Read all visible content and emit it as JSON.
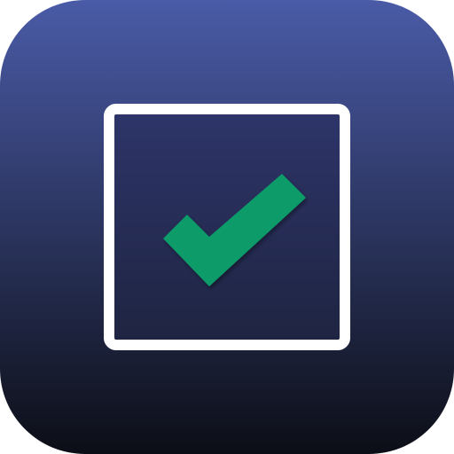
{
  "icon": {
    "name": "checkbox-checked-app-icon",
    "colors": {
      "background_top": "#4A5BA7",
      "background_bottom": "#0C0E16",
      "box_stroke": "#FFFFFF",
      "box_fill_top": "#2E356A",
      "box_fill_bottom": "#1E2440",
      "check": "#0B9B6A"
    },
    "state": {
      "checked": true
    }
  }
}
